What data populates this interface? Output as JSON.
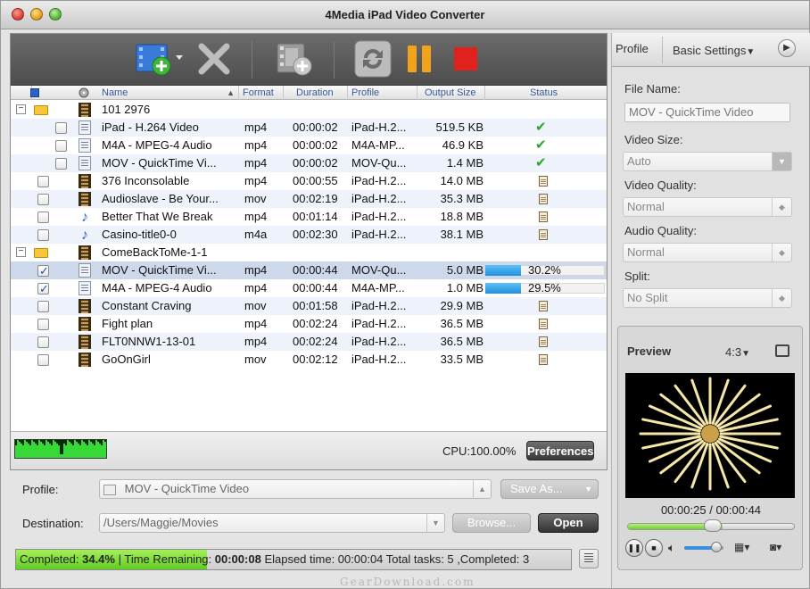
{
  "window": {
    "title": "4Media iPad Video Converter"
  },
  "colors": {
    "toolbar": "#555555",
    "selected_row": "#cdd9ea",
    "progress_blue": "#2a95e5",
    "status_green": "#6ed52b",
    "check_green": "#27a52c"
  },
  "toolbar": {
    "add_icon": "add-video-icon",
    "remove_icon": "remove-x-icon",
    "add_segment_icon": "add-segment-icon",
    "convert_icon": "convert-icon",
    "pause_icon": "pause-icon",
    "stop_icon": "stop-icon"
  },
  "table": {
    "columns": {
      "name": "Name",
      "format": "Format",
      "duration": "Duration",
      "profile": "Profile",
      "output_size": "Output Size",
      "status": "Status"
    },
    "rows": [
      {
        "type": "group",
        "name": "101 2976"
      },
      {
        "type": "item",
        "icon": "doc",
        "checked": false,
        "name": "iPad - H.264 Video",
        "format": "mp4",
        "duration": "00:00:02",
        "profile": "iPad-H.2...",
        "size": "519.5 KB",
        "status": "done"
      },
      {
        "type": "item",
        "icon": "doc",
        "checked": false,
        "name": "M4A - MPEG-4 Audio",
        "format": "mp4",
        "duration": "00:00:02",
        "profile": "M4A-MP...",
        "size": "46.9 KB",
        "status": "done"
      },
      {
        "type": "item",
        "icon": "doc",
        "checked": false,
        "name": "MOV - QuickTime Vi...",
        "format": "mp4",
        "duration": "00:00:02",
        "profile": "MOV-Qu...",
        "size": "1.4 MB",
        "status": "done"
      },
      {
        "type": "item",
        "icon": "film",
        "checked": false,
        "indent": "top",
        "name": "376 Inconsolable",
        "format": "mp4",
        "duration": "00:00:55",
        "profile": "iPad-H.2...",
        "size": "14.0 MB",
        "status": "wait"
      },
      {
        "type": "item",
        "icon": "film",
        "checked": false,
        "indent": "top",
        "name": "Audioslave - Be Your...",
        "format": "mov",
        "duration": "00:02:19",
        "profile": "iPad-H.2...",
        "size": "35.3 MB",
        "status": "wait"
      },
      {
        "type": "item",
        "icon": "note",
        "checked": false,
        "indent": "top",
        "name": "Better That We Break",
        "format": "mp4",
        "duration": "00:01:14",
        "profile": "iPad-H.2...",
        "size": "18.8 MB",
        "status": "wait"
      },
      {
        "type": "item",
        "icon": "note",
        "checked": false,
        "indent": "top",
        "name": "Casino-title0-0",
        "format": "m4a",
        "duration": "00:02:30",
        "profile": "iPad-H.2...",
        "size": "38.1 MB",
        "status": "wait"
      },
      {
        "type": "group",
        "name": "ComeBackToMe-1-1"
      },
      {
        "type": "item",
        "icon": "doc",
        "checked": true,
        "selected": true,
        "indent": "top",
        "name": "MOV - QuickTime Vi...",
        "format": "mp4",
        "duration": "00:00:44",
        "profile": "MOV-Qu...",
        "size": "5.0 MB",
        "status": "progress",
        "progress_text": "30.2%",
        "progress": 0.302
      },
      {
        "type": "item",
        "icon": "doc",
        "checked": true,
        "indent": "top",
        "name": "M4A - MPEG-4 Audio",
        "format": "mp4",
        "duration": "00:00:44",
        "profile": "M4A-MP...",
        "size": "1.0 MB",
        "status": "progress",
        "progress_text": "29.5%",
        "progress": 0.295
      },
      {
        "type": "item",
        "icon": "film",
        "checked": false,
        "indent": "top",
        "name": "Constant Craving",
        "format": "mov",
        "duration": "00:01:58",
        "profile": "iPad-H.2...",
        "size": "29.9 MB",
        "status": "wait"
      },
      {
        "type": "item",
        "icon": "film",
        "checked": false,
        "indent": "top",
        "name": "Fight plan",
        "format": "mp4",
        "duration": "00:02:24",
        "profile": "iPad-H.2...",
        "size": "36.5 MB",
        "status": "wait"
      },
      {
        "type": "item",
        "icon": "film",
        "checked": false,
        "indent": "top",
        "name": "FLT0NNW1-13-01",
        "format": "mp4",
        "duration": "00:02:24",
        "profile": "iPad-H.2...",
        "size": "36.5 MB",
        "status": "wait"
      },
      {
        "type": "item",
        "icon": "film",
        "checked": false,
        "indent": "top",
        "name": "GoOnGirl",
        "format": "mov",
        "duration": "00:02:12",
        "profile": "iPad-H.2...",
        "size": "33.5 MB",
        "status": "wait"
      }
    ]
  },
  "cpu": {
    "text": "CPU:100.00%",
    "preferences_label": "Preferences"
  },
  "bottom": {
    "profile_label": "Profile:",
    "profile_value": "MOV - QuickTime Video",
    "save_as_label": "Save As...",
    "destination_label": "Destination:",
    "destination_value": "/Users/Maggie/Movies",
    "browse_label": "Browse...",
    "open_label": "Open"
  },
  "status": {
    "completed_label": "Completed:",
    "completed_value": "34.4%",
    "remaining_label": "| Time Remaining:",
    "remaining_value": "00:00:08",
    "rest": "Elapsed time: 00:00:04 Total tasks: 5 ,Completed: 3",
    "progress": 0.344
  },
  "right": {
    "tab_profile": "Profile",
    "tab_basic": "Basic Settings",
    "file_name_label": "File Name:",
    "file_name_value": "MOV - QuickTime Video",
    "video_size_label": "Video Size:",
    "video_size_value": "Auto",
    "video_quality_label": "Video Quality:",
    "video_quality_value": "Normal",
    "audio_quality_label": "Audio Quality:",
    "audio_quality_value": "Normal",
    "split_label": "Split:",
    "split_value": "No Split"
  },
  "preview": {
    "title": "Preview",
    "ratio": "4:3",
    "time_current": "00:00:25",
    "time_sep": "/",
    "time_total": "00:00:44",
    "seek_progress": 0.57,
    "volume_level": 0.7
  },
  "watermark": "GearDownload.com"
}
